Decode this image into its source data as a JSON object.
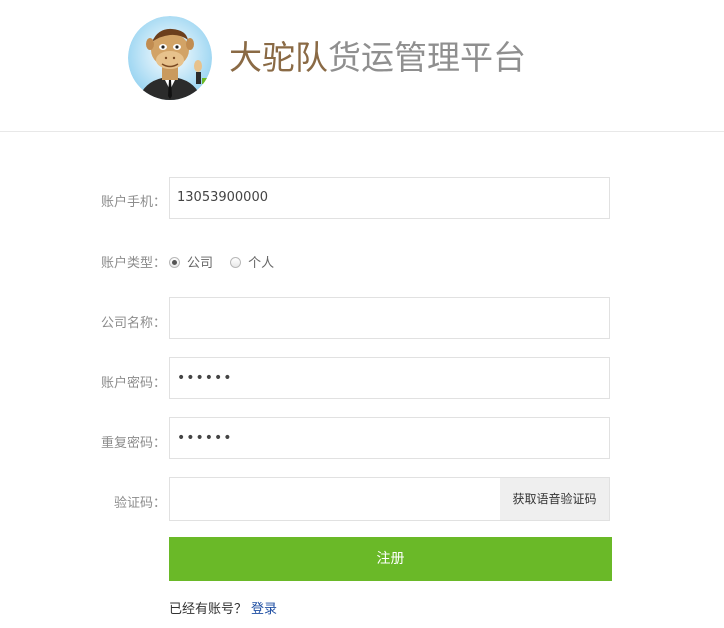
{
  "header": {
    "brand_primary": "大驼队",
    "brand_secondary": "货运管理平台",
    "brand_primary_color": "#8a6a45",
    "brand_secondary_color": "#8f8f8f",
    "logo_icon": "camel-mascot-icon"
  },
  "form": {
    "phone": {
      "label": "账户手机：",
      "value": "13053900000"
    },
    "account_type": {
      "label": "账户类型：",
      "options": [
        {
          "label": "公司",
          "checked": true
        },
        {
          "label": "个人",
          "checked": false
        }
      ]
    },
    "company_name": {
      "label": "公司名称：",
      "value": ""
    },
    "password": {
      "label": "账户密码：",
      "value": "••••••"
    },
    "confirm_password": {
      "label": "重复密码：",
      "value": "••••••"
    },
    "verification": {
      "label": "验证码：",
      "value": "",
      "button_label": "获取语音验证码"
    },
    "submit_label": "注册",
    "submit_color": "#6ab928",
    "has_account_text": "已经有账号？",
    "login_link_text": "登录"
  }
}
